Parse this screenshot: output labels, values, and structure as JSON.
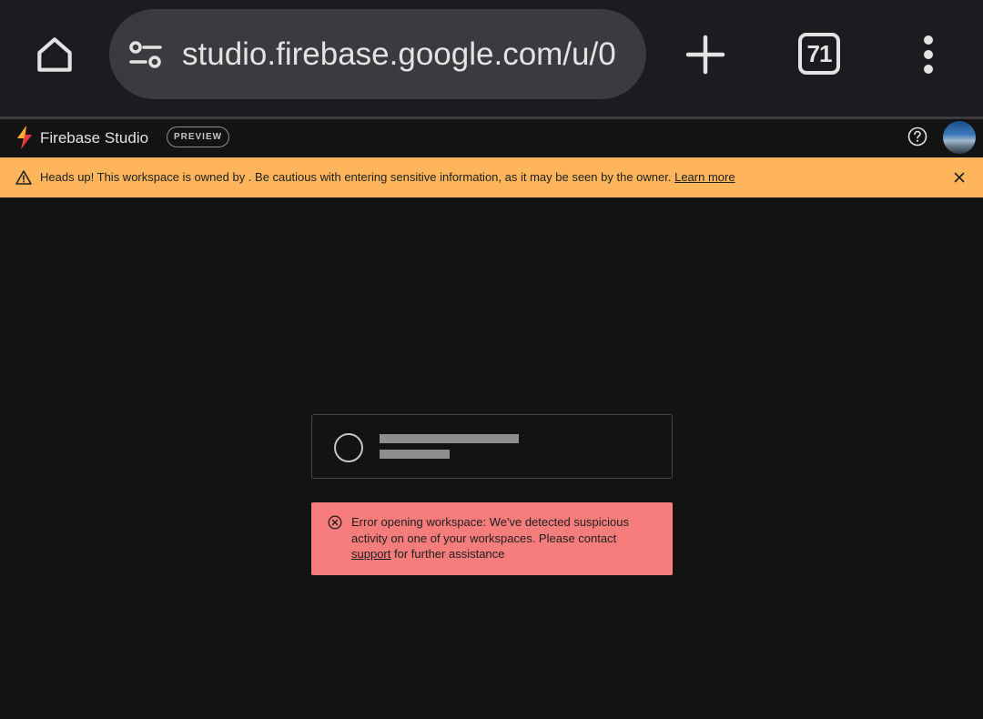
{
  "browser": {
    "url": "studio.firebase.google.com/u/0",
    "tab_count": "71"
  },
  "header": {
    "app_name": "Firebase Studio",
    "badge": "PREVIEW"
  },
  "banner": {
    "message": "Heads up! This workspace is owned by . Be cautious with entering sensitive information, as it may be seen by the owner.",
    "link": "Learn more",
    "color": "#ffb55c"
  },
  "error": {
    "message_before": "Error opening workspace: We've detected suspicious activity on one of your workspaces. Please contact",
    "link": "support",
    "message_after": "for further assistance",
    "color": "#f77c7c"
  }
}
